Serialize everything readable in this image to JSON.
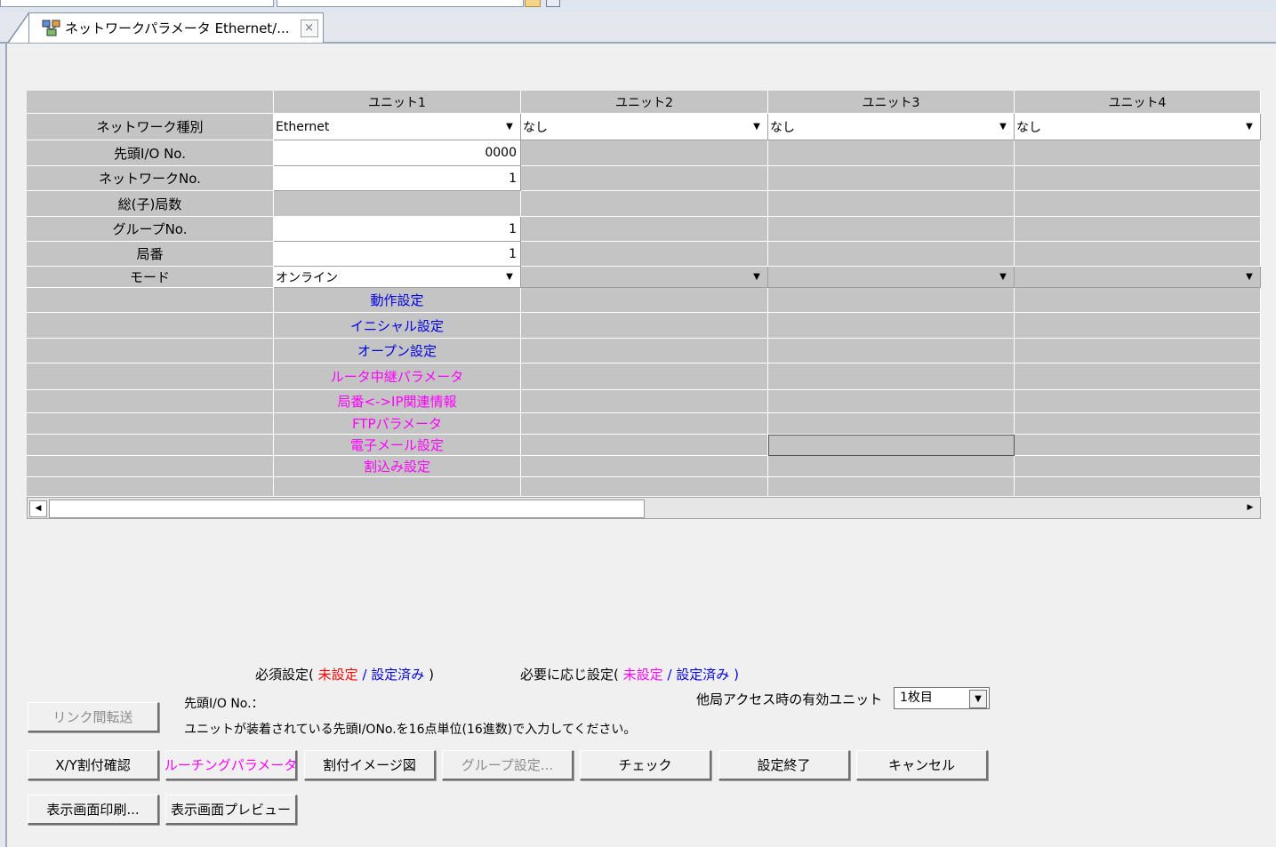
{
  "tab": {
    "title": "ネットワークパラメータ Ethernet/...",
    "close": "×"
  },
  "grid": {
    "headers": [
      "ユニット1",
      "ユニット2",
      "ユニット3",
      "ユニット4"
    ],
    "row_labels": {
      "network_type": "ネットワーク種別",
      "io_no": "先頭I/O No.",
      "network_no": "ネットワークNo.",
      "total_stations": "総(子)局数",
      "group_no": "グループNo.",
      "station_no": "局番",
      "mode": "モード"
    },
    "network_type": [
      "Ethernet",
      "なし",
      "なし",
      "なし"
    ],
    "io_no": "0000",
    "network_no": "1",
    "group_no": "1",
    "station_no": "1",
    "mode": "オンライン",
    "settings": [
      {
        "label": "動作設定",
        "color": "#0000e0"
      },
      {
        "label": "イニシャル設定",
        "color": "#0000e0"
      },
      {
        "label": "オープン設定",
        "color": "#0000e0"
      },
      {
        "label": "ルータ中継パラメータ",
        "color": "#ff00ff"
      },
      {
        "label": "局番<->IP関連情報",
        "color": "#ff00ff"
      },
      {
        "label": "FTPパラメータ",
        "color": "#ff00ff"
      },
      {
        "label": "電子メール設定",
        "color": "#ff00ff"
      },
      {
        "label": "割込み設定",
        "color": "#ff00ff"
      }
    ]
  },
  "legend": {
    "required_prefix": "必須設定(",
    "required_unset": "未設定",
    "sep": "/",
    "required_set": "設定済み",
    "close": ")",
    "optional_prefix": "必要に応じ設定(",
    "optional_unset": "未設定",
    "optional_set": "設定済み"
  },
  "note": {
    "title": "先頭I/O No.：",
    "body": "ユニットが装着されている先頭I/ONo.を16点単位(16進数)で入力してください。"
  },
  "access": {
    "label": "他局アクセス時の有効ユニット",
    "value": "1枚目"
  },
  "buttons": {
    "link_transfer": "リンク間転送",
    "xy_assign": "X/Y割付確認",
    "routing": "ルーチングパラメータ",
    "assign_image": "割付イメージ図",
    "group_settings": "グループ設定...",
    "check": "チェック",
    "finish": "設定終了",
    "cancel": "キャンセル",
    "print": "表示画面印刷...",
    "preview": "表示画面プレビュー"
  },
  "colors": {
    "required_unset": "#ff0000",
    "set": "#0000e0",
    "optional_unset": "#ff00ff"
  }
}
